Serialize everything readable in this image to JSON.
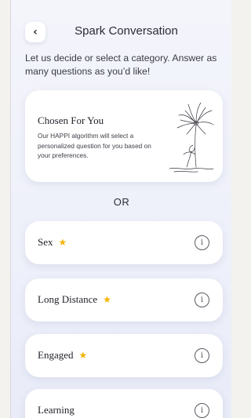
{
  "header": {
    "back_icon": "chevron-left-icon",
    "back_glyph": "‹",
    "title": "Spark Conversation"
  },
  "intro_text": "Let us decide or select a category. Answer as many questions as you’d like!",
  "chosen_card": {
    "title": "Chosen For You",
    "description": "Our HAPPI algorithm will select a personalized question for you based on your preferences.",
    "illustration": "flower-illustration"
  },
  "divider_label": "OR",
  "categories": [
    {
      "label": "Sex",
      "starred": true,
      "star_glyph": "★",
      "info_glyph": "i"
    },
    {
      "label": "Long Distance",
      "starred": true,
      "star_glyph": "★",
      "info_glyph": "i"
    },
    {
      "label": "Engaged",
      "starred": true,
      "star_glyph": "★",
      "info_glyph": "i"
    },
    {
      "label": "Learning",
      "starred": false,
      "star_glyph": "",
      "info_glyph": "i"
    }
  ],
  "colors": {
    "star": "#f5b400",
    "background": "#eef0fa",
    "card": "#ffffff",
    "text": "#1f1f28"
  }
}
